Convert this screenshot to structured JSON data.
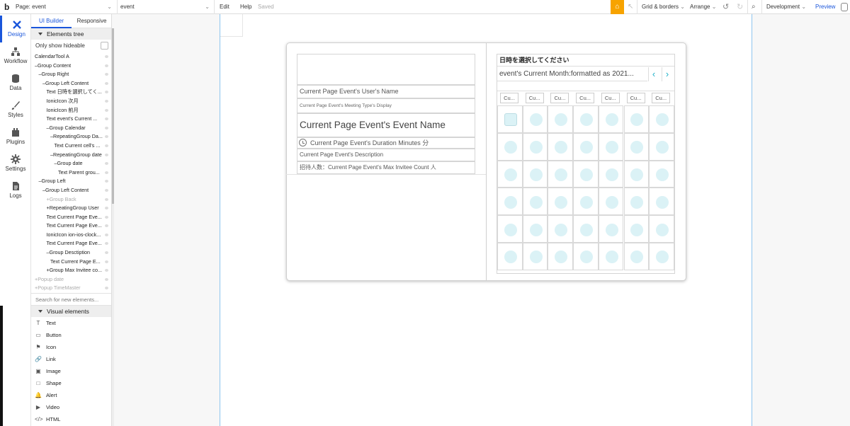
{
  "topbar": {
    "logo": "b",
    "page_selector": "Page: event",
    "element_selector": "event",
    "menu_edit": "Edit",
    "menu_help": "Help",
    "saved_status": "Saved",
    "grid_borders": "Grid & borders",
    "arrange": "Arrange",
    "environment": "Development",
    "preview": "Preview",
    "accent_color": "#f7a300"
  },
  "iconrail": {
    "items": [
      {
        "label": "Design",
        "icon": "design-icon"
      },
      {
        "label": "Workflow",
        "icon": "workflow-icon"
      },
      {
        "label": "Data",
        "icon": "data-icon"
      },
      {
        "label": "Styles",
        "icon": "styles-icon"
      },
      {
        "label": "Plugins",
        "icon": "plugins-icon"
      },
      {
        "label": "Settings",
        "icon": "settings-icon"
      },
      {
        "label": "Logs",
        "icon": "logs-icon"
      }
    ]
  },
  "panel": {
    "tab_ui_builder": "UI Builder",
    "tab_responsive": "Responsive",
    "elements_tree_title": "Elements tree",
    "only_show_hideable": "Only show hideable",
    "tree": [
      {
        "label": "CalendarTool A",
        "indent": 0,
        "faded": false,
        "prefix": ""
      },
      {
        "label": "Group Content",
        "indent": 0,
        "faded": false,
        "prefix": "–"
      },
      {
        "label": "Group Right",
        "indent": 1,
        "faded": false,
        "prefix": "–"
      },
      {
        "label": "Group Left Content",
        "indent": 2,
        "faded": false,
        "prefix": "–"
      },
      {
        "label": "Text 日時を選択してく...",
        "indent": 3,
        "faded": false,
        "prefix": ""
      },
      {
        "label": "IonicIcon 次月",
        "indent": 3,
        "faded": false,
        "prefix": ""
      },
      {
        "label": "IonicIcon 前月",
        "indent": 3,
        "faded": false,
        "prefix": ""
      },
      {
        "label": "Text event's Current ...",
        "indent": 3,
        "faded": false,
        "prefix": ""
      },
      {
        "label": "Group Calendar",
        "indent": 3,
        "faded": false,
        "prefix": "–"
      },
      {
        "label": "RepeatingGroup Da...",
        "indent": 4,
        "faded": false,
        "prefix": "–"
      },
      {
        "label": "Text Current cell's ...",
        "indent": 5,
        "faded": false,
        "prefix": ""
      },
      {
        "label": "RepeatingGroup date",
        "indent": 4,
        "faded": false,
        "prefix": "–"
      },
      {
        "label": "Group date",
        "indent": 5,
        "faded": false,
        "prefix": "–"
      },
      {
        "label": "Text Parent grou...",
        "indent": 6,
        "faded": false,
        "prefix": ""
      },
      {
        "label": "Group Left",
        "indent": 1,
        "faded": false,
        "prefix": "–"
      },
      {
        "label": "Group Left Content",
        "indent": 2,
        "faded": false,
        "prefix": "–"
      },
      {
        "label": "Group Back",
        "indent": 3,
        "faded": true,
        "prefix": "+"
      },
      {
        "label": "RepeatingGroup User",
        "indent": 3,
        "faded": false,
        "prefix": "+"
      },
      {
        "label": "Text Current Page Eve...",
        "indent": 3,
        "faded": false,
        "prefix": ""
      },
      {
        "label": "Text Current Page Eve...",
        "indent": 3,
        "faded": false,
        "prefix": ""
      },
      {
        "label": "IonicIcon ion-ios-clock...",
        "indent": 3,
        "faded": false,
        "prefix": ""
      },
      {
        "label": "Text Current Page Eve...",
        "indent": 3,
        "faded": false,
        "prefix": ""
      },
      {
        "label": "Group Desctiption",
        "indent": 3,
        "faded": false,
        "prefix": "–"
      },
      {
        "label": "Text Current Page E...",
        "indent": 4,
        "faded": false,
        "prefix": ""
      },
      {
        "label": "Group Max Invitee co...",
        "indent": 3,
        "faded": false,
        "prefix": "+"
      },
      {
        "label": "Popup date",
        "indent": 0,
        "faded": true,
        "prefix": "+"
      },
      {
        "label": "Popup TimeMaster",
        "indent": 0,
        "faded": true,
        "prefix": "+"
      }
    ],
    "search_placeholder": "Search for new elements...",
    "visual_elements_title": "Visual elements",
    "visual_elements": [
      {
        "label": "Text",
        "icon": "T"
      },
      {
        "label": "Button",
        "icon": "▭"
      },
      {
        "label": "Icon",
        "icon": "⚑"
      },
      {
        "label": "Link",
        "icon": "🔗"
      },
      {
        "label": "Image",
        "icon": "▣"
      },
      {
        "label": "Shape",
        "icon": "□"
      },
      {
        "label": "Alert",
        "icon": "🔔"
      },
      {
        "label": "Video",
        "icon": "▶"
      },
      {
        "label": "HTML",
        "icon": "</>"
      }
    ]
  },
  "canvas": {
    "user_name": "Current Page Event's User's Name",
    "meeting_type": "Current Page Event's Meeting Type's Display",
    "event_name": "Current Page Event's Event Name",
    "duration": "Current Page Event's Duration Minutes 分",
    "description": "Current Page Event's Description",
    "max_invitee": "招待人数：Current Page Event's Max Invitee Count 人",
    "calendar_title": "日時を選択してください",
    "current_month": "event's Current Month:formatted as 2021...",
    "prev_arrow": "‹",
    "next_arrow": "›",
    "day_headers": [
      "Cu...",
      "Cu...",
      "Cu...",
      "Cu...",
      "Cu...",
      "Cu...",
      "Cu..."
    ],
    "dot_color": "#dbf2f6",
    "arrow_color": "#1eb0c8"
  }
}
